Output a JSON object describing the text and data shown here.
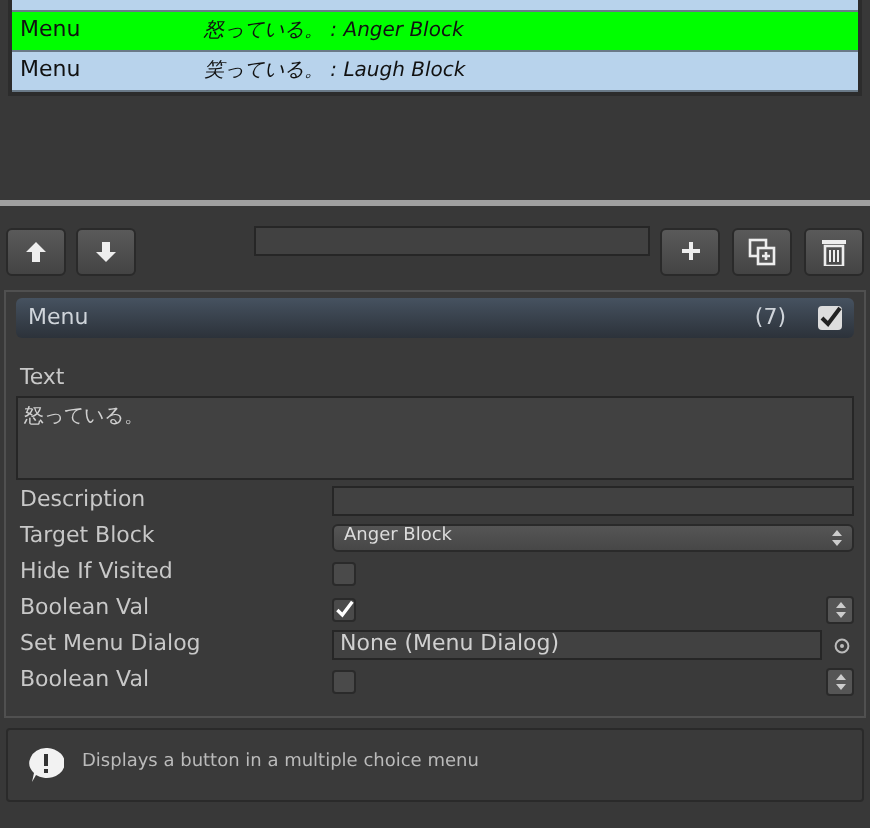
{
  "command_list": {
    "rows": [
      {
        "name": "Menu",
        "summary": "怒っている。 : Anger Block",
        "selected": true
      },
      {
        "name": "Menu",
        "summary": "笑っている。 : Laugh Block",
        "selected": false
      }
    ]
  },
  "command": {
    "title": "Menu",
    "count": "(7)",
    "enabled": true,
    "text": {
      "label": "Text",
      "value": "怒っている。"
    },
    "properties": [
      {
        "kind": "text",
        "label": "Description"
      },
      {
        "kind": "dropdown",
        "label": "Target Block",
        "value": "Anger Block"
      },
      {
        "kind": "checkbox",
        "label": "Hide If Visited",
        "checked": false
      },
      {
        "kind": "checkbox",
        "label": "Boolean Val",
        "checked": true,
        "spinner": true
      },
      {
        "kind": "object",
        "label": "Set Menu Dialog",
        "value": "None (Menu Dialog)"
      },
      {
        "kind": "checkbox",
        "label": "Boolean Val",
        "checked": false,
        "spinner": true
      }
    ]
  },
  "help": {
    "text": "Displays a button in a multiple choice menu"
  }
}
